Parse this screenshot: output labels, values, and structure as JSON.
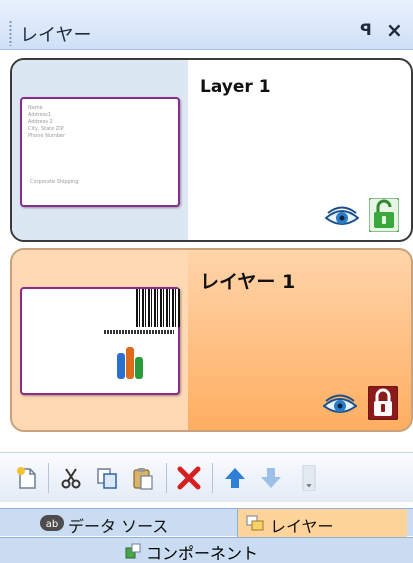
{
  "panel": {
    "title": "レイヤー",
    "pin_label": "ꟼ",
    "close_label": "×"
  },
  "layers": [
    {
      "name": "Layer 1",
      "visible": true,
      "locked": false,
      "thumbnail": {
        "lines": [
          "Name",
          "Address1",
          "Address 2",
          "City, State ZIP",
          "Phone Number"
        ],
        "footer": "Corporate Shipping"
      }
    },
    {
      "name": "レイヤー 1",
      "visible": true,
      "locked": true,
      "selected": true
    }
  ],
  "toolbar": {
    "buttons": [
      "new-layer-icon",
      "cut-icon",
      "copy-icon",
      "paste-icon",
      "delete-icon",
      "move-up-icon",
      "move-down-icon",
      "overflow-icon"
    ]
  },
  "tabs": {
    "data_source": "データ ソース",
    "layer": "レイヤー",
    "components": "コンポーネント"
  },
  "colors": {
    "selected_layer": "#ffae60",
    "lock_unlocked": "#3aa83a",
    "lock_locked": "#8b1a1a",
    "delete": "#d42020",
    "arrow_up": "#2f7fd6"
  }
}
